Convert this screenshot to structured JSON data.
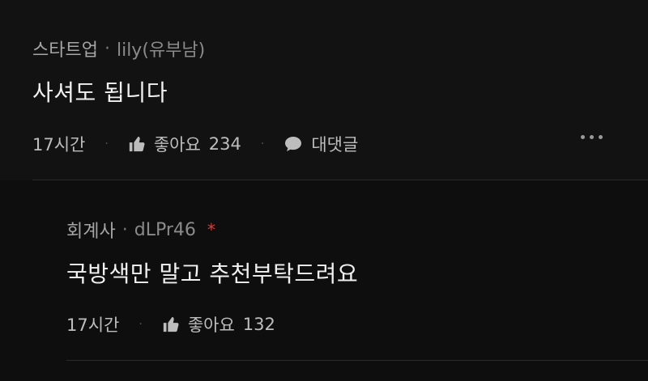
{
  "comments": [
    {
      "category": "스타트업",
      "separator": "·",
      "username": "lily(유부남)",
      "text": "사셔도 됩니다",
      "time": "17시간",
      "like_label": "좋아요",
      "like_count": "234",
      "reply_label": "대댓글",
      "action_sep": "·"
    },
    {
      "category": "회계사",
      "separator": "·",
      "username": "dLPr46",
      "badge": "*",
      "text": "국방색만 말고 추천부탁드려요",
      "time": "17시간",
      "like_label": "좋아요",
      "like_count": "132",
      "action_sep": "·"
    }
  ]
}
